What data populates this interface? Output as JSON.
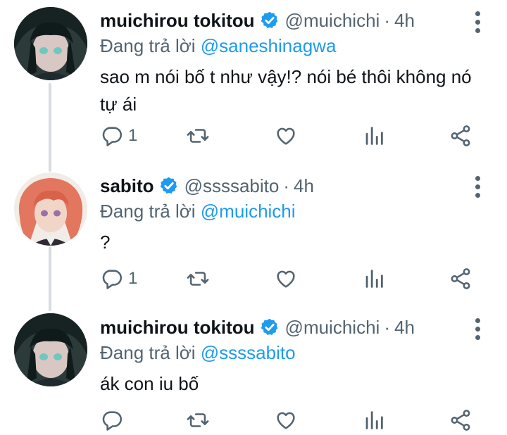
{
  "tweets": [
    {
      "name": "muichirou tokitou",
      "handle": "@muichichi",
      "separator": "·",
      "time": "4h",
      "reply_prefix": "Đang trả lời ",
      "reply_to": "@saneshinagwa",
      "text": "sao m nói bố t như vậy!? nói bé thôi không nó tự ái",
      "reply_count": "1",
      "avatar": "dark-haired-character"
    },
    {
      "name": "sabito",
      "handle": "@ssssabito",
      "separator": "·",
      "time": "4h",
      "reply_prefix": "Đang trả lời ",
      "reply_to": "@muichichi",
      "text": "?",
      "reply_count": "1",
      "avatar": "red-haired-character"
    },
    {
      "name": "muichirou tokitou",
      "handle": "@muichichi",
      "separator": "·",
      "time": "4h",
      "reply_prefix": "Đang trả lời ",
      "reply_to": "@ssssabito",
      "text": "ák con iu bố",
      "reply_count": "",
      "avatar": "dark-haired-character"
    }
  ],
  "colors": {
    "accent": "#1d9bf0",
    "muted": "#536471",
    "thread_line": "#d8dde1"
  },
  "icons": [
    "verified-badge-icon",
    "more-icon",
    "reply-icon",
    "retweet-icon",
    "like-icon",
    "analytics-icon",
    "share-icon"
  ]
}
